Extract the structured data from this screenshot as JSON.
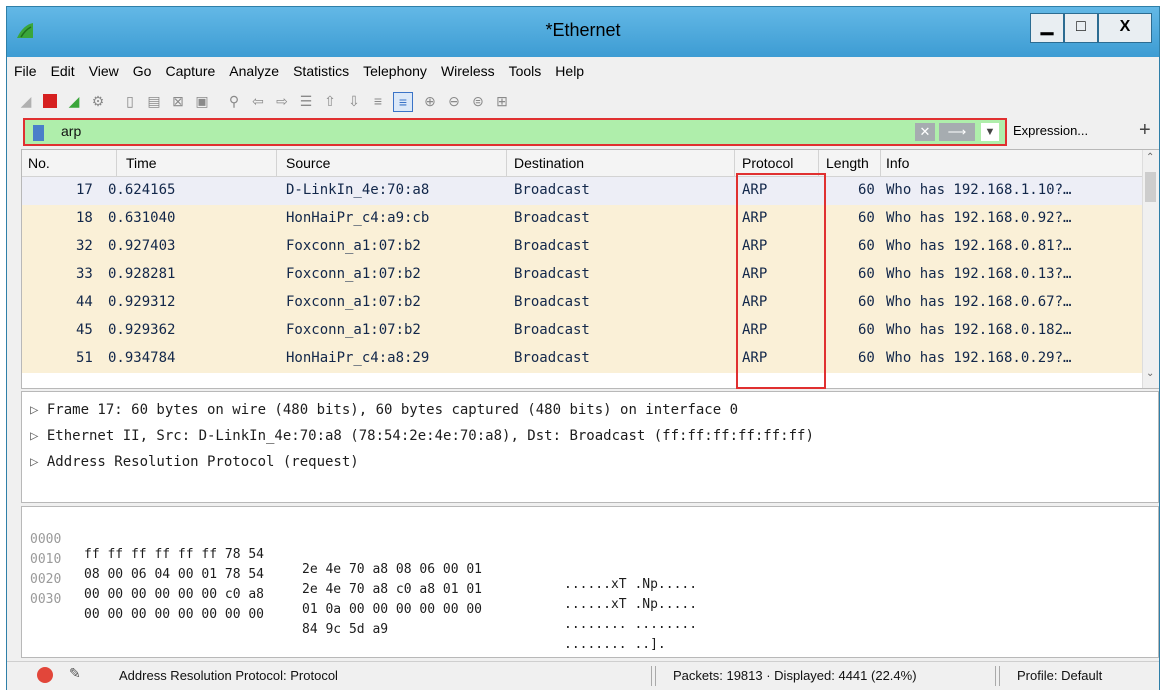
{
  "window": {
    "title": "*Ethernet",
    "accent": "#4aa7dd"
  },
  "menu": [
    "File",
    "Edit",
    "View",
    "Go",
    "Capture",
    "Analyze",
    "Statistics",
    "Telephony",
    "Wireless",
    "Tools",
    "Help"
  ],
  "toolbar": {
    "icons": [
      "shark-fin-icon",
      "stop-icon",
      "restart-icon",
      "options-gear-icon",
      "open-file-icon",
      "save-file-icon",
      "close-file-icon",
      "reload-icon",
      "find-icon",
      "go-back-icon",
      "go-forward-icon",
      "go-to-packet-icon",
      "first-packet-icon",
      "last-packet-icon",
      "autoscroll-icon",
      "colorize-icon",
      "zoom-in-icon",
      "zoom-out-icon",
      "normal-size-icon",
      "resize-columns-icon"
    ]
  },
  "filter": {
    "value": "arp",
    "expression_label": "Expression...",
    "add_label": "+",
    "bg_color": "#afeeab",
    "highlight_color": "#e03030"
  },
  "packet_list": {
    "columns": [
      "No.",
      "Time",
      "Source",
      "Destination",
      "Protocol",
      "Length",
      "Info"
    ],
    "rows": [
      {
        "no": "17",
        "time": "0.624165",
        "source": "D-LinkIn_4e:70:a8",
        "destination": "Broadcast",
        "protocol": "ARP",
        "length": "60",
        "info": "Who has 192.168.1.10?…"
      },
      {
        "no": "18",
        "time": "0.631040",
        "source": "HonHaiPr_c4:a9:cb",
        "destination": "Broadcast",
        "protocol": "ARP",
        "length": "60",
        "info": "Who has 192.168.0.92?…"
      },
      {
        "no": "32",
        "time": "0.927403",
        "source": "Foxconn_a1:07:b2",
        "destination": "Broadcast",
        "protocol": "ARP",
        "length": "60",
        "info": "Who has 192.168.0.81?…"
      },
      {
        "no": "33",
        "time": "0.928281",
        "source": "Foxconn_a1:07:b2",
        "destination": "Broadcast",
        "protocol": "ARP",
        "length": "60",
        "info": "Who has 192.168.0.13?…"
      },
      {
        "no": "44",
        "time": "0.929312",
        "source": "Foxconn_a1:07:b2",
        "destination": "Broadcast",
        "protocol": "ARP",
        "length": "60",
        "info": "Who has 192.168.0.67?…"
      },
      {
        "no": "45",
        "time": "0.929362",
        "source": "Foxconn_a1:07:b2",
        "destination": "Broadcast",
        "protocol": "ARP",
        "length": "60",
        "info": "Who has 192.168.0.182…"
      },
      {
        "no": "51",
        "time": "0.934784",
        "source": "HonHaiPr_c4:a8:29",
        "destination": "Broadcast",
        "protocol": "ARP",
        "length": "60",
        "info": "Who has 192.168.0.29?…"
      }
    ],
    "selected_row_color": "#edeef6",
    "row_color": "#faf0d7"
  },
  "details": [
    "Frame 17: 60 bytes on wire (480 bits), 60 bytes captured (480 bits) on interface 0",
    "Ethernet II, Src: D-LinkIn_4e:70:a8 (78:54:2e:4e:70:a8), Dst: Broadcast (ff:ff:ff:ff:ff:ff)",
    "Address Resolution Protocol (request)"
  ],
  "bytes": [
    {
      "offset": "0000",
      "hex1": "ff ff ff ff ff ff 78 54",
      "hex2": "2e 4e 70 a8 08 06 00 01",
      "ascii": "......xT .Np....."
    },
    {
      "offset": "0010",
      "hex1": "08 00 06 04 00 01 78 54",
      "hex2": "2e 4e 70 a8 c0 a8 01 01",
      "ascii": "......xT .Np....."
    },
    {
      "offset": "0020",
      "hex1": "00 00 00 00 00 00 c0 a8",
      "hex2": "01 0a 00 00 00 00 00 00",
      "ascii": "........ ........"
    },
    {
      "offset": "0030",
      "hex1": "00 00 00 00 00 00 00 00",
      "hex2": "84 9c 5d a9",
      "ascii": "........ ..]."
    }
  ],
  "status": {
    "protocol_text": "Address Resolution Protocol: Protocol",
    "packets_text": "Packets: 19813 · Displayed: 4441 (22.4%)",
    "profile_text": "Profile: Default"
  }
}
